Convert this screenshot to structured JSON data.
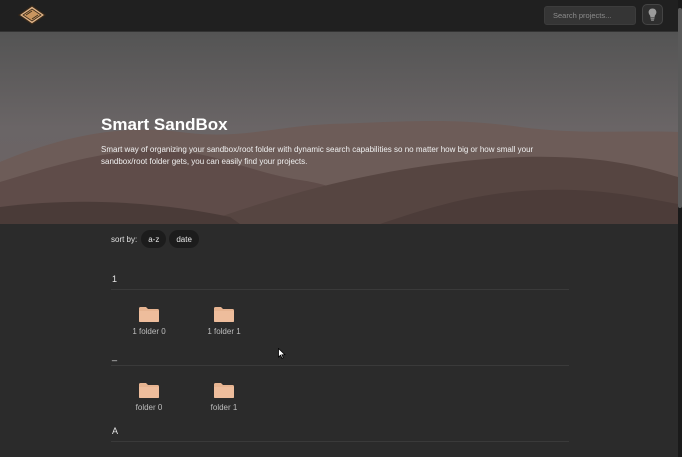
{
  "navbar": {
    "logo_icon": "sandbox-logo-icon",
    "search_placeholder": "Search projects...",
    "theme_toggle_icon": "lightbulb-icon"
  },
  "hero": {
    "title": "Smart SandBox",
    "description": "Smart way of organizing your sandbox/root folder with dynamic search capabilities so no matter how big or how small your sandbox/root folder gets, you can easily find your projects."
  },
  "sort": {
    "label": "sort by:",
    "options": [
      "a-z",
      "date"
    ]
  },
  "groups": [
    {
      "header": "1",
      "folders": [
        "1 folder 0",
        "1 folder 1"
      ]
    },
    {
      "header": "_",
      "folders": [
        "folder 0",
        "folder 1"
      ]
    },
    {
      "header": "A",
      "folders": []
    }
  ],
  "colors": {
    "background": "#2b2b2b",
    "navbar": "#202020",
    "folder": "#e7b491",
    "sort_button": "#1c1c1c"
  }
}
